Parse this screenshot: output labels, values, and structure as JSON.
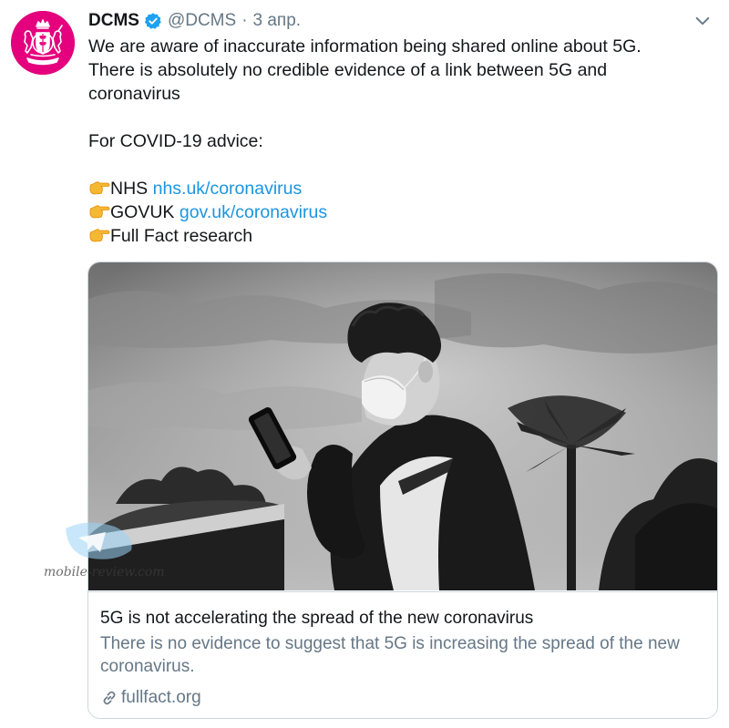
{
  "tweet": {
    "display_name": "DCMS",
    "handle": "@DCMS",
    "separator": "·",
    "date": "3 апр.",
    "lines": [
      "We are aware of inaccurate information being shared online about 5G.",
      "There is absolutely no credible evidence of a link between 5G and",
      "coronavirus"
    ],
    "advice_heading": "For COVID-19 advice:",
    "resources": [
      {
        "label": "NHS",
        "link": "nhs.uk/coronavirus"
      },
      {
        "label": "GOVUK",
        "link": "gov.uk/coronavirus"
      },
      {
        "label": "Full Fact research",
        "link": ""
      }
    ],
    "card": {
      "title": "5G is not accelerating the spread of the new coronavirus",
      "description": "There is no evidence to suggest that 5G is increasing the spread of the new coronavirus.",
      "domain": "fullfact.org"
    }
  },
  "watermark": {
    "text": "mobile-review.com"
  },
  "colors": {
    "avatar_bg": "#e5007d",
    "link": "#1b95e0",
    "secondary_text": "#657786",
    "verified": "#1da1f2",
    "border": "#ccd6dd"
  },
  "icons": {
    "avatar": "royal-crest-icon",
    "verified": "verified-badge-icon",
    "menu": "chevron-down-icon",
    "pointing": "backhand-index-pointing-right-icon",
    "link": "link-icon"
  }
}
